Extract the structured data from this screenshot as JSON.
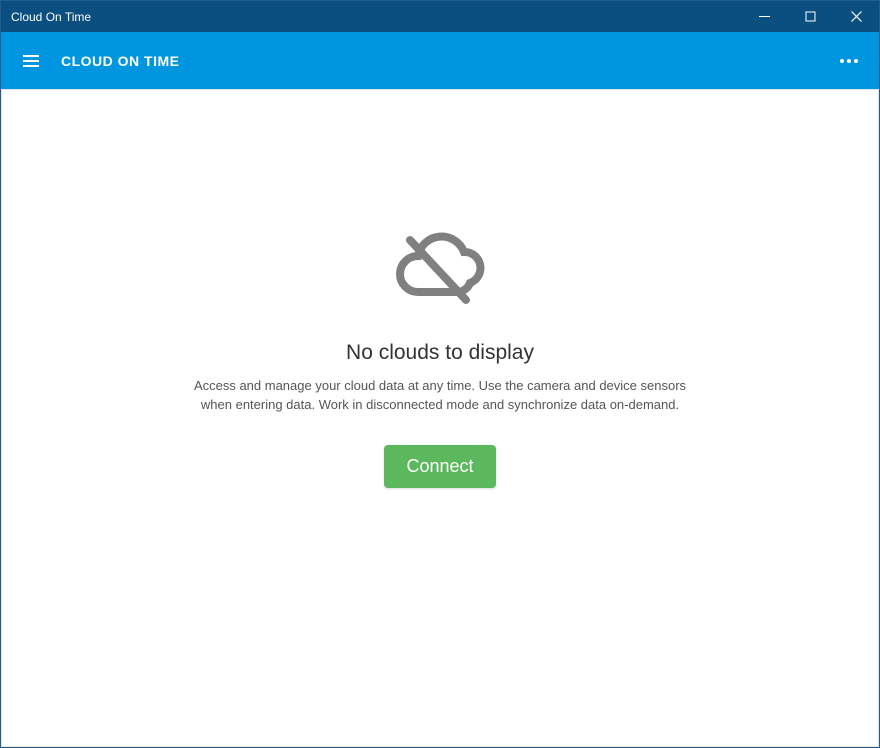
{
  "window": {
    "title": "Cloud On Time"
  },
  "appbar": {
    "title": "CLOUD ON TIME"
  },
  "main": {
    "heading": "No clouds to display",
    "description": "Access and manage your cloud data at any time. Use the camera and device sensors when entering data. Work in disconnected mode and synchronize data on-demand.",
    "connect_label": "Connect"
  },
  "colors": {
    "titlebar": "#0b4f81",
    "appbar": "#0096df",
    "button_primary": "#5cb85c"
  }
}
